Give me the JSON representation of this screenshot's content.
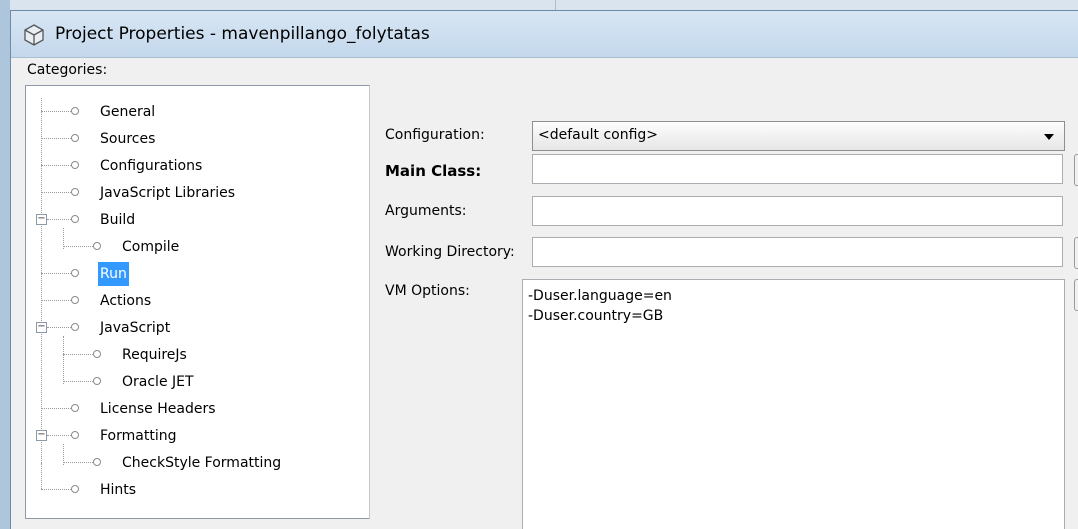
{
  "window": {
    "title": "Project Properties - mavenpillango_folytatas"
  },
  "categories": {
    "label": "Categories:",
    "items": [
      {
        "label": "General"
      },
      {
        "label": "Sources"
      },
      {
        "label": "Configurations"
      },
      {
        "label": "JavaScript Libraries"
      },
      {
        "label": "Build"
      },
      {
        "label": "Compile"
      },
      {
        "label": "Run",
        "selected": true
      },
      {
        "label": "Actions"
      },
      {
        "label": "JavaScript"
      },
      {
        "label": "RequireJs"
      },
      {
        "label": "Oracle JET"
      },
      {
        "label": "License Headers"
      },
      {
        "label": "Formatting"
      },
      {
        "label": "CheckStyle Formatting"
      },
      {
        "label": "Hints"
      }
    ]
  },
  "form": {
    "configuration_label": "Configuration:",
    "configuration_value": "<default config>",
    "main_class_label": "Main Class:",
    "main_class_value": "",
    "arguments_label": "Arguments:",
    "arguments_value": "",
    "working_directory_label": "Working Directory:",
    "working_directory_value": "",
    "vm_options_label": "VM Options:",
    "vm_options_lines": [
      "-Duser.language=en",
      "-Duser.country=GB"
    ]
  },
  "colors": {
    "selection": "#3399ff",
    "titlebar": "#c4d8ec"
  }
}
